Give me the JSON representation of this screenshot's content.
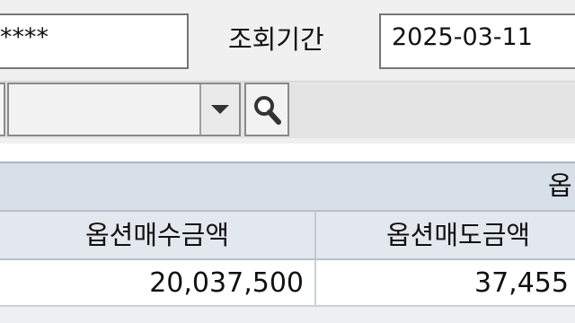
{
  "filter": {
    "account_value": "****",
    "period_label": "조회기간",
    "date_value": "2025-03-11",
    "combo_value": ""
  },
  "grid": {
    "group_header": "옵",
    "columns": [
      "옵션매수금액",
      "옵션매도금액"
    ],
    "rows": [
      [
        "20,037,500",
        "37,455"
      ]
    ]
  },
  "icons": {
    "combo_arrow": "chevron-down-icon",
    "search": "search-icon"
  },
  "colors": {
    "header_bg": "#d7dfe8",
    "column_header_bg": "#e3e8ee",
    "field_border": "#767676"
  }
}
